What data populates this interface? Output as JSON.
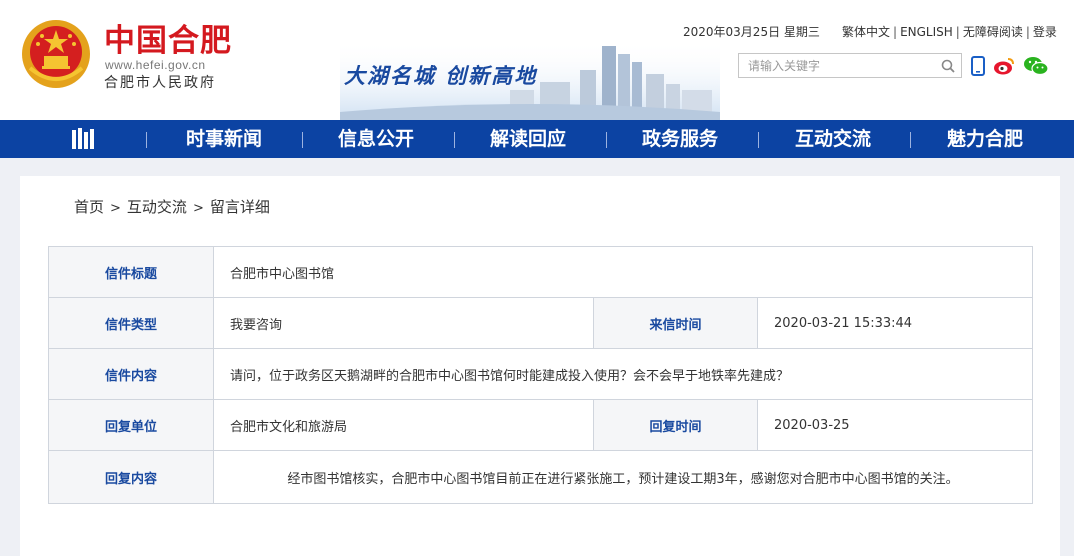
{
  "header": {
    "logo_title": "中国合肥",
    "logo_url": "www.hefei.gov.cn",
    "logo_subtitle": "合肥市人民政府",
    "slogan": "大湖名城  创新高地",
    "date": "2020年03月25日 星期三",
    "links": [
      "繁体中文",
      "ENGLISH",
      "无障碍阅读",
      "登录"
    ],
    "search_placeholder": "请输入关键字",
    "colors": {
      "brand_red": "#d4191f",
      "nav_blue": "#0c43a3",
      "weibo": "#e6162d",
      "wechat": "#2ab31f"
    }
  },
  "nav": {
    "items": [
      "时事新闻",
      "信息公开",
      "解读回应",
      "政务服务",
      "互动交流",
      "魅力合肥"
    ]
  },
  "breadcrumb": [
    "首页",
    "互动交流",
    "留言详细"
  ],
  "letter": {
    "title_label": "信件标题",
    "title": "合肥市中心图书馆",
    "type_label": "信件类型",
    "type": "我要咨询",
    "time_label": "来信时间",
    "time": "2020-03-21 15:33:44",
    "content_label": "信件内容",
    "content": "请问，位于政务区天鹅湖畔的合肥市中心图书馆何时能建成投入使用？会不会早于地铁率先建成？",
    "reply_unit_label": "回复单位",
    "reply_unit": "合肥市文化和旅游局",
    "reply_time_label": "回复时间",
    "reply_time": "2020-03-25",
    "reply_content_label": "回复内容",
    "reply_content": "经市图书馆核实，合肥市中心图书馆目前正在进行紧张施工，预计建设工期3年，感谢您对合肥市中心图书馆的关注。"
  }
}
